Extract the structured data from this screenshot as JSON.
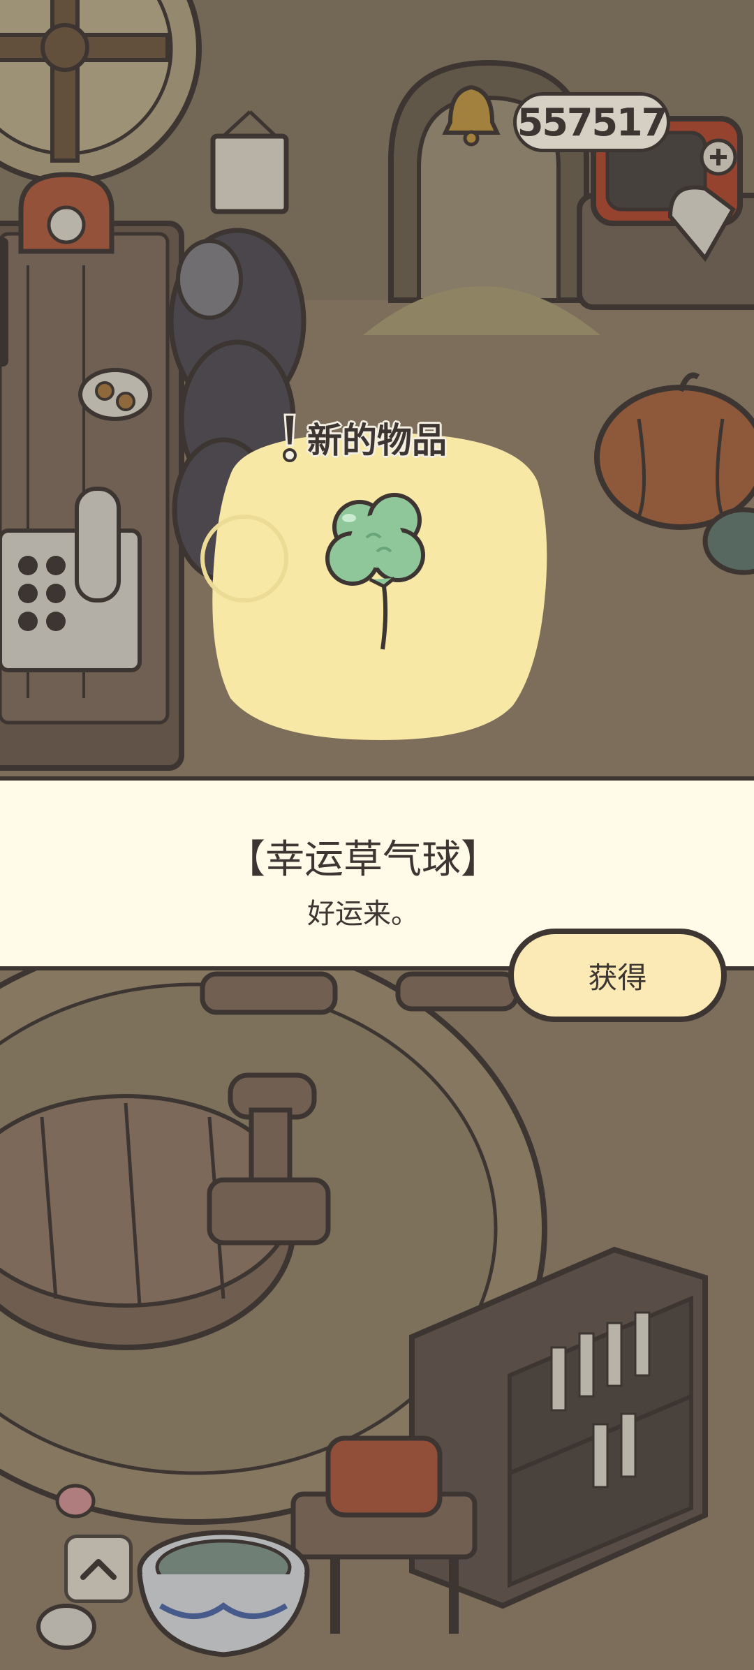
{
  "hud": {
    "counter_value": "557517",
    "add_icon": "plus-icon",
    "bell_icon": "bell-icon"
  },
  "popup": {
    "title": "新的物品",
    "item_icon": "clover-balloon-icon",
    "item_name": "【幸运草气球】",
    "item_description": "好运来。",
    "get_label": "获得"
  },
  "nav": {
    "up_icon": "chevron-up-icon"
  },
  "colors": {
    "outline": "#3c3531",
    "band_background": "#fffbe8",
    "button_fill": "#fbeab5",
    "spotlight": "#f7e8a6",
    "clover_green": "#8fc79a"
  }
}
